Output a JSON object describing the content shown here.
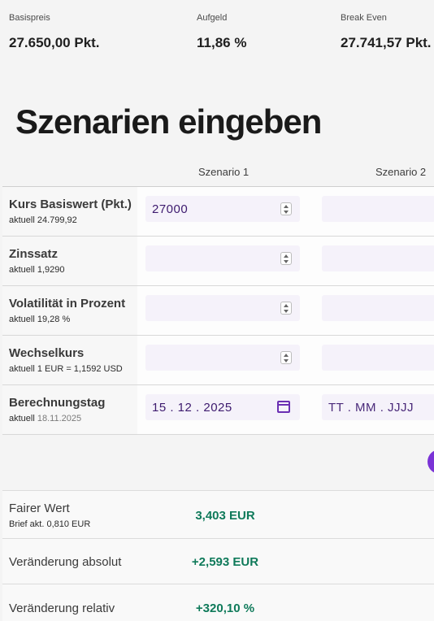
{
  "summary": [
    {
      "label": "Basispreis",
      "value": "27.650,00 Pkt."
    },
    {
      "label": "Aufgeld",
      "value": "11,86 %"
    },
    {
      "label": "Break Even",
      "value": "27.741,57 Pkt."
    }
  ],
  "title": "Szenarien eingeben",
  "columns": [
    "Szenario 1",
    "Szenario 2"
  ],
  "rows": [
    {
      "label": "Kurs Basiswert (Pkt.)",
      "sub_prefix": "aktuell",
      "sub_value": "24.799,92",
      "s1": "27000",
      "s2": ""
    },
    {
      "label": "Zinssatz",
      "sub_prefix": "aktuell",
      "sub_value": "1,9290",
      "s1": "",
      "s2": ""
    },
    {
      "label": "Volatilität in Prozent",
      "sub_prefix": "aktuell",
      "sub_value": "19,28 %",
      "s1": "",
      "s2": ""
    },
    {
      "label": "Wechselkurs",
      "sub_prefix": "aktuell",
      "sub_value": "1 EUR = 1,1592 USD",
      "s1": "",
      "s2": ""
    },
    {
      "label": "Berechnungstag",
      "sub_prefix": "aktuell",
      "sub_value": "18.11.2025",
      "s1": "15 . 12 . 2025",
      "s2_placeholder": "TT . MM . JJJJ"
    }
  ],
  "results": [
    {
      "label": "Fairer Wert",
      "sub": "Brief akt. 0,810 EUR",
      "value": "3,403 EUR"
    },
    {
      "label": "Veränderung absolut",
      "value": "+2,593 EUR"
    },
    {
      "label": "Veränderung relativ",
      "value": "+320,10 %"
    }
  ],
  "colors": {
    "accent": "#7a33d6",
    "positive": "#0f7a5a",
    "input_bg": "#f5f2fa"
  },
  "icons": {
    "spinner": "spinner-icon",
    "calendar": "calendar-icon",
    "fab": "circle-button"
  }
}
